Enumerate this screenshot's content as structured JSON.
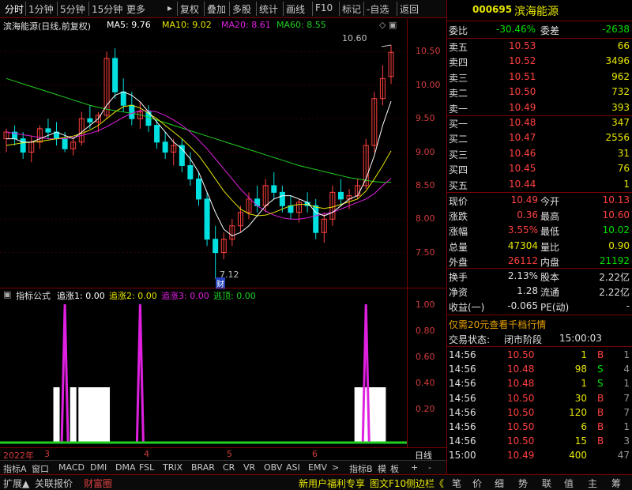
{
  "toolbar": {
    "items": [
      "分时",
      "1分钟",
      "5分钟",
      "15分钟",
      "更多",
      "复权",
      "叠加",
      "多股",
      "统计",
      "画线",
      "F10",
      "标记",
      "-自选",
      "返回"
    ],
    "more_arrow": "▸"
  },
  "title": {
    "name": "滨海能源(日线,前复权)",
    "ma5": "MA5: 9.76",
    "ma10": "MA10: 9.02",
    "ma20": "MA20: 8.61",
    "ma60": "MA60: 8.55",
    "collapse": "◇ ▣"
  },
  "colors": {
    "up": "#ff4040",
    "down": "#00e0e0",
    "ma5": "#ffffff",
    "ma10": "#e6e600",
    "ma20": "#e020e0",
    "ma60": "#20d020"
  },
  "price_axis": [
    "10.50",
    "10.00",
    "9.50",
    "9.00",
    "8.50",
    "8.00",
    "7.50"
  ],
  "annotations": {
    "high": "10.60",
    "low": "7.12",
    "fin_badge": "财"
  },
  "indicator": {
    "name": "指标公式",
    "z1": "追涨1: 0.00",
    "z2": "追涨2: 0.00",
    "z3": "追涨3: 0.00",
    "tp": "逃顶: 0.00",
    "axis": [
      "1.00",
      "0.80",
      "0.60",
      "0.40",
      "0.20"
    ]
  },
  "date_axis": {
    "year": "2022年",
    "months": [
      "3",
      "4",
      "5",
      "6"
    ],
    "period": "日线"
  },
  "bottom_tabs": [
    "指标A",
    "窗口",
    "MACD",
    "DMI",
    "DMA",
    "FSL",
    "TRIX",
    "BRAR",
    "CR",
    "VR",
    "OBV",
    "ASI",
    "EMV",
    ">",
    "指标B",
    "模",
    "板",
    "+",
    "-"
  ],
  "status_left": [
    "扩展▲",
    "关联报价",
    "财富圈"
  ],
  "status_right": [
    "新用户福利专享",
    "图文F10",
    "侧边栏《",
    "笔",
    "价",
    "细",
    "势",
    "联",
    "值",
    "主",
    "筹"
  ],
  "quote": {
    "code": "000695",
    "name": "滨海能源",
    "weibi_label": "委比",
    "weibi": "-30.46%",
    "weicha_label": "委差",
    "weicha": "-2638",
    "sells": [
      {
        "l": "卖五",
        "p": "10.53",
        "v": "66"
      },
      {
        "l": "卖四",
        "p": "10.52",
        "v": "3496"
      },
      {
        "l": "卖三",
        "p": "10.51",
        "v": "962"
      },
      {
        "l": "卖二",
        "p": "10.50",
        "v": "732"
      },
      {
        "l": "卖一",
        "p": "10.49",
        "v": "393"
      }
    ],
    "buys": [
      {
        "l": "买一",
        "p": "10.48",
        "v": "347"
      },
      {
        "l": "买二",
        "p": "10.47",
        "v": "2556"
      },
      {
        "l": "买三",
        "p": "10.46",
        "v": "31"
      },
      {
        "l": "买四",
        "p": "10.45",
        "v": "76"
      },
      {
        "l": "买五",
        "p": "10.44",
        "v": "1"
      }
    ],
    "stats": [
      {
        "a": "现价",
        "av": "10.49",
        "b": "今开",
        "bv": "10.13"
      },
      {
        "a": "涨跌",
        "av": "0.36",
        "b": "最高",
        "bv": "10.60"
      },
      {
        "a": "涨幅",
        "av": "3.55%",
        "b": "最低",
        "bv": "10.02"
      },
      {
        "a": "总量",
        "av": "47304",
        "b": "量比",
        "bv": "0.90"
      },
      {
        "a": "外盘",
        "av": "26112",
        "b": "内盘",
        "bv": "21192"
      }
    ],
    "stats2": [
      {
        "a": "换手",
        "av": "2.13%",
        "b": "股本",
        "bv": "2.22亿"
      },
      {
        "a": "净资",
        "av": "1.28",
        "b": "流通",
        "bv": "2.22亿"
      },
      {
        "a": "收益(一)",
        "av": "-0.065",
        "b": "PE(动)",
        "bv": "-"
      }
    ],
    "promo": "仅需20元查看千档行情",
    "trade_status_label": "交易状态:",
    "trade_status": "闭市阶段",
    "trade_time": "15:00:03",
    "ticks": [
      {
        "t": "14:56",
        "p": "10.50",
        "v": "1",
        "s": "B",
        "n": "1"
      },
      {
        "t": "14:56",
        "p": "10.48",
        "v": "98",
        "s": "S",
        "n": "4"
      },
      {
        "t": "14:56",
        "p": "10.48",
        "v": "1",
        "s": "S",
        "n": "1"
      },
      {
        "t": "14:56",
        "p": "10.50",
        "v": "30",
        "s": "B",
        "n": "7"
      },
      {
        "t": "14:56",
        "p": "10.50",
        "v": "120",
        "s": "B",
        "n": "7"
      },
      {
        "t": "14:56",
        "p": "10.50",
        "v": "6",
        "s": "B",
        "n": "1"
      },
      {
        "t": "14:56",
        "p": "10.50",
        "v": "15",
        "s": "B",
        "n": "3"
      },
      {
        "t": "15:00",
        "p": "10.49",
        "v": "400",
        "s": "",
        "n": "47"
      }
    ]
  },
  "chart_data": {
    "type": "candlestick",
    "indicator_type": "step",
    "ylim": [
      7.0,
      10.8
    ],
    "series_names": [
      "MA5",
      "MA10",
      "MA20",
      "MA60"
    ],
    "candles": [
      [
        9.2,
        9.35,
        9.0,
        9.3
      ],
      [
        9.3,
        9.4,
        9.1,
        9.2
      ],
      [
        9.2,
        9.3,
        8.9,
        9.0
      ],
      [
        9.0,
        9.25,
        8.85,
        9.15
      ],
      [
        9.15,
        9.4,
        9.05,
        9.35
      ],
      [
        9.35,
        9.5,
        9.2,
        9.3
      ],
      [
        9.3,
        9.45,
        9.1,
        9.2
      ],
      [
        9.2,
        9.3,
        9.0,
        9.05
      ],
      [
        9.05,
        9.2,
        8.95,
        9.15
      ],
      [
        9.15,
        9.6,
        9.1,
        9.5
      ],
      [
        9.5,
        9.7,
        9.35,
        9.45
      ],
      [
        9.45,
        9.6,
        9.3,
        9.55
      ],
      [
        9.55,
        10.5,
        9.5,
        10.4
      ],
      [
        10.4,
        10.55,
        9.8,
        9.9
      ],
      [
        9.9,
        10.1,
        9.6,
        9.7
      ],
      [
        9.7,
        9.9,
        9.4,
        9.5
      ],
      [
        9.5,
        9.75,
        9.35,
        9.6
      ],
      [
        9.6,
        9.7,
        9.3,
        9.4
      ],
      [
        9.4,
        9.5,
        9.05,
        9.15
      ],
      [
        9.15,
        9.3,
        8.9,
        9.0
      ],
      [
        9.0,
        9.2,
        8.8,
        9.1
      ],
      [
        9.1,
        9.2,
        8.7,
        8.8
      ],
      [
        8.8,
        9.0,
        8.5,
        8.6
      ],
      [
        8.6,
        8.7,
        8.2,
        8.3
      ],
      [
        8.3,
        8.4,
        7.6,
        7.7
      ],
      [
        7.7,
        7.9,
        7.12,
        7.5
      ],
      [
        7.5,
        7.8,
        7.4,
        7.7
      ],
      [
        7.7,
        8.0,
        7.6,
        7.9
      ],
      [
        7.9,
        8.2,
        7.8,
        8.1
      ],
      [
        8.1,
        8.4,
        8.0,
        8.3
      ],
      [
        8.3,
        8.5,
        8.1,
        8.2
      ],
      [
        8.2,
        8.6,
        8.1,
        8.5
      ],
      [
        8.5,
        8.7,
        8.3,
        8.4
      ],
      [
        8.4,
        8.5,
        8.1,
        8.2
      ],
      [
        8.2,
        8.35,
        8.0,
        8.1
      ],
      [
        8.1,
        8.3,
        7.95,
        8.25
      ],
      [
        8.25,
        8.4,
        8.1,
        8.2
      ],
      [
        8.2,
        8.3,
        7.7,
        7.8
      ],
      [
        7.8,
        8.1,
        7.65,
        8.0
      ],
      [
        8.0,
        8.5,
        7.9,
        8.4
      ],
      [
        8.4,
        8.6,
        8.2,
        8.3
      ],
      [
        8.3,
        8.45,
        8.15,
        8.35
      ],
      [
        8.35,
        8.6,
        8.3,
        8.5
      ],
      [
        8.5,
        9.2,
        8.45,
        9.1
      ],
      [
        9.1,
        9.9,
        9.0,
        9.8
      ],
      [
        9.8,
        10.3,
        9.7,
        10.1
      ],
      [
        10.13,
        10.6,
        10.02,
        10.49
      ]
    ],
    "ma5": [
      9.2,
      9.2,
      9.15,
      9.15,
      9.2,
      9.25,
      9.3,
      9.25,
      9.2,
      9.3,
      9.4,
      9.5,
      9.7,
      9.85,
      9.9,
      9.85,
      9.75,
      9.6,
      9.45,
      9.3,
      9.15,
      9.05,
      8.9,
      8.7,
      8.4,
      8.1,
      7.85,
      7.75,
      7.8,
      7.9,
      8.05,
      8.2,
      8.3,
      8.35,
      8.35,
      8.3,
      8.25,
      8.1,
      8.05,
      8.1,
      8.2,
      8.3,
      8.35,
      8.6,
      8.95,
      9.4,
      9.76
    ],
    "ma10": [
      9.1,
      9.12,
      9.14,
      9.15,
      9.16,
      9.18,
      9.2,
      9.22,
      9.24,
      9.28,
      9.33,
      9.4,
      9.5,
      9.6,
      9.68,
      9.7,
      9.66,
      9.58,
      9.5,
      9.4,
      9.3,
      9.2,
      9.08,
      8.95,
      8.78,
      8.6,
      8.42,
      8.28,
      8.15,
      8.08,
      8.05,
      8.06,
      8.1,
      8.15,
      8.2,
      8.22,
      8.22,
      8.18,
      8.16,
      8.18,
      8.22,
      8.26,
      8.3,
      8.42,
      8.6,
      8.8,
      9.02
    ],
    "ma20": [
      9.3,
      9.28,
      9.26,
      9.24,
      9.22,
      9.2,
      9.2,
      9.2,
      9.22,
      9.25,
      9.28,
      9.32,
      9.38,
      9.45,
      9.52,
      9.58,
      9.62,
      9.62,
      9.6,
      9.55,
      9.48,
      9.4,
      9.3,
      9.18,
      9.05,
      8.9,
      8.75,
      8.6,
      8.45,
      8.32,
      8.2,
      8.12,
      8.06,
      8.02,
      8.0,
      8.0,
      8.02,
      8.05,
      8.08,
      8.1,
      8.15,
      8.2,
      8.25,
      8.3,
      8.38,
      8.5,
      8.61
    ],
    "ma60": [
      10.1,
      10.06,
      10.02,
      9.98,
      9.94,
      9.9,
      9.86,
      9.82,
      9.78,
      9.74,
      9.7,
      9.67,
      9.64,
      9.62,
      9.6,
      9.58,
      9.56,
      9.52,
      9.48,
      9.44,
      9.4,
      9.36,
      9.32,
      9.28,
      9.24,
      9.2,
      9.16,
      9.12,
      9.08,
      9.04,
      9.0,
      8.96,
      8.92,
      8.88,
      8.84,
      8.8,
      8.77,
      8.74,
      8.71,
      8.68,
      8.65,
      8.62,
      8.6,
      8.58,
      8.56,
      8.55,
      8.55
    ],
    "signal_spikes": [
      7,
      16,
      43
    ],
    "signal_blocks": [
      [
        6,
        6
      ],
      [
        8,
        8
      ],
      [
        9,
        12
      ],
      [
        42,
        45
      ]
    ]
  }
}
